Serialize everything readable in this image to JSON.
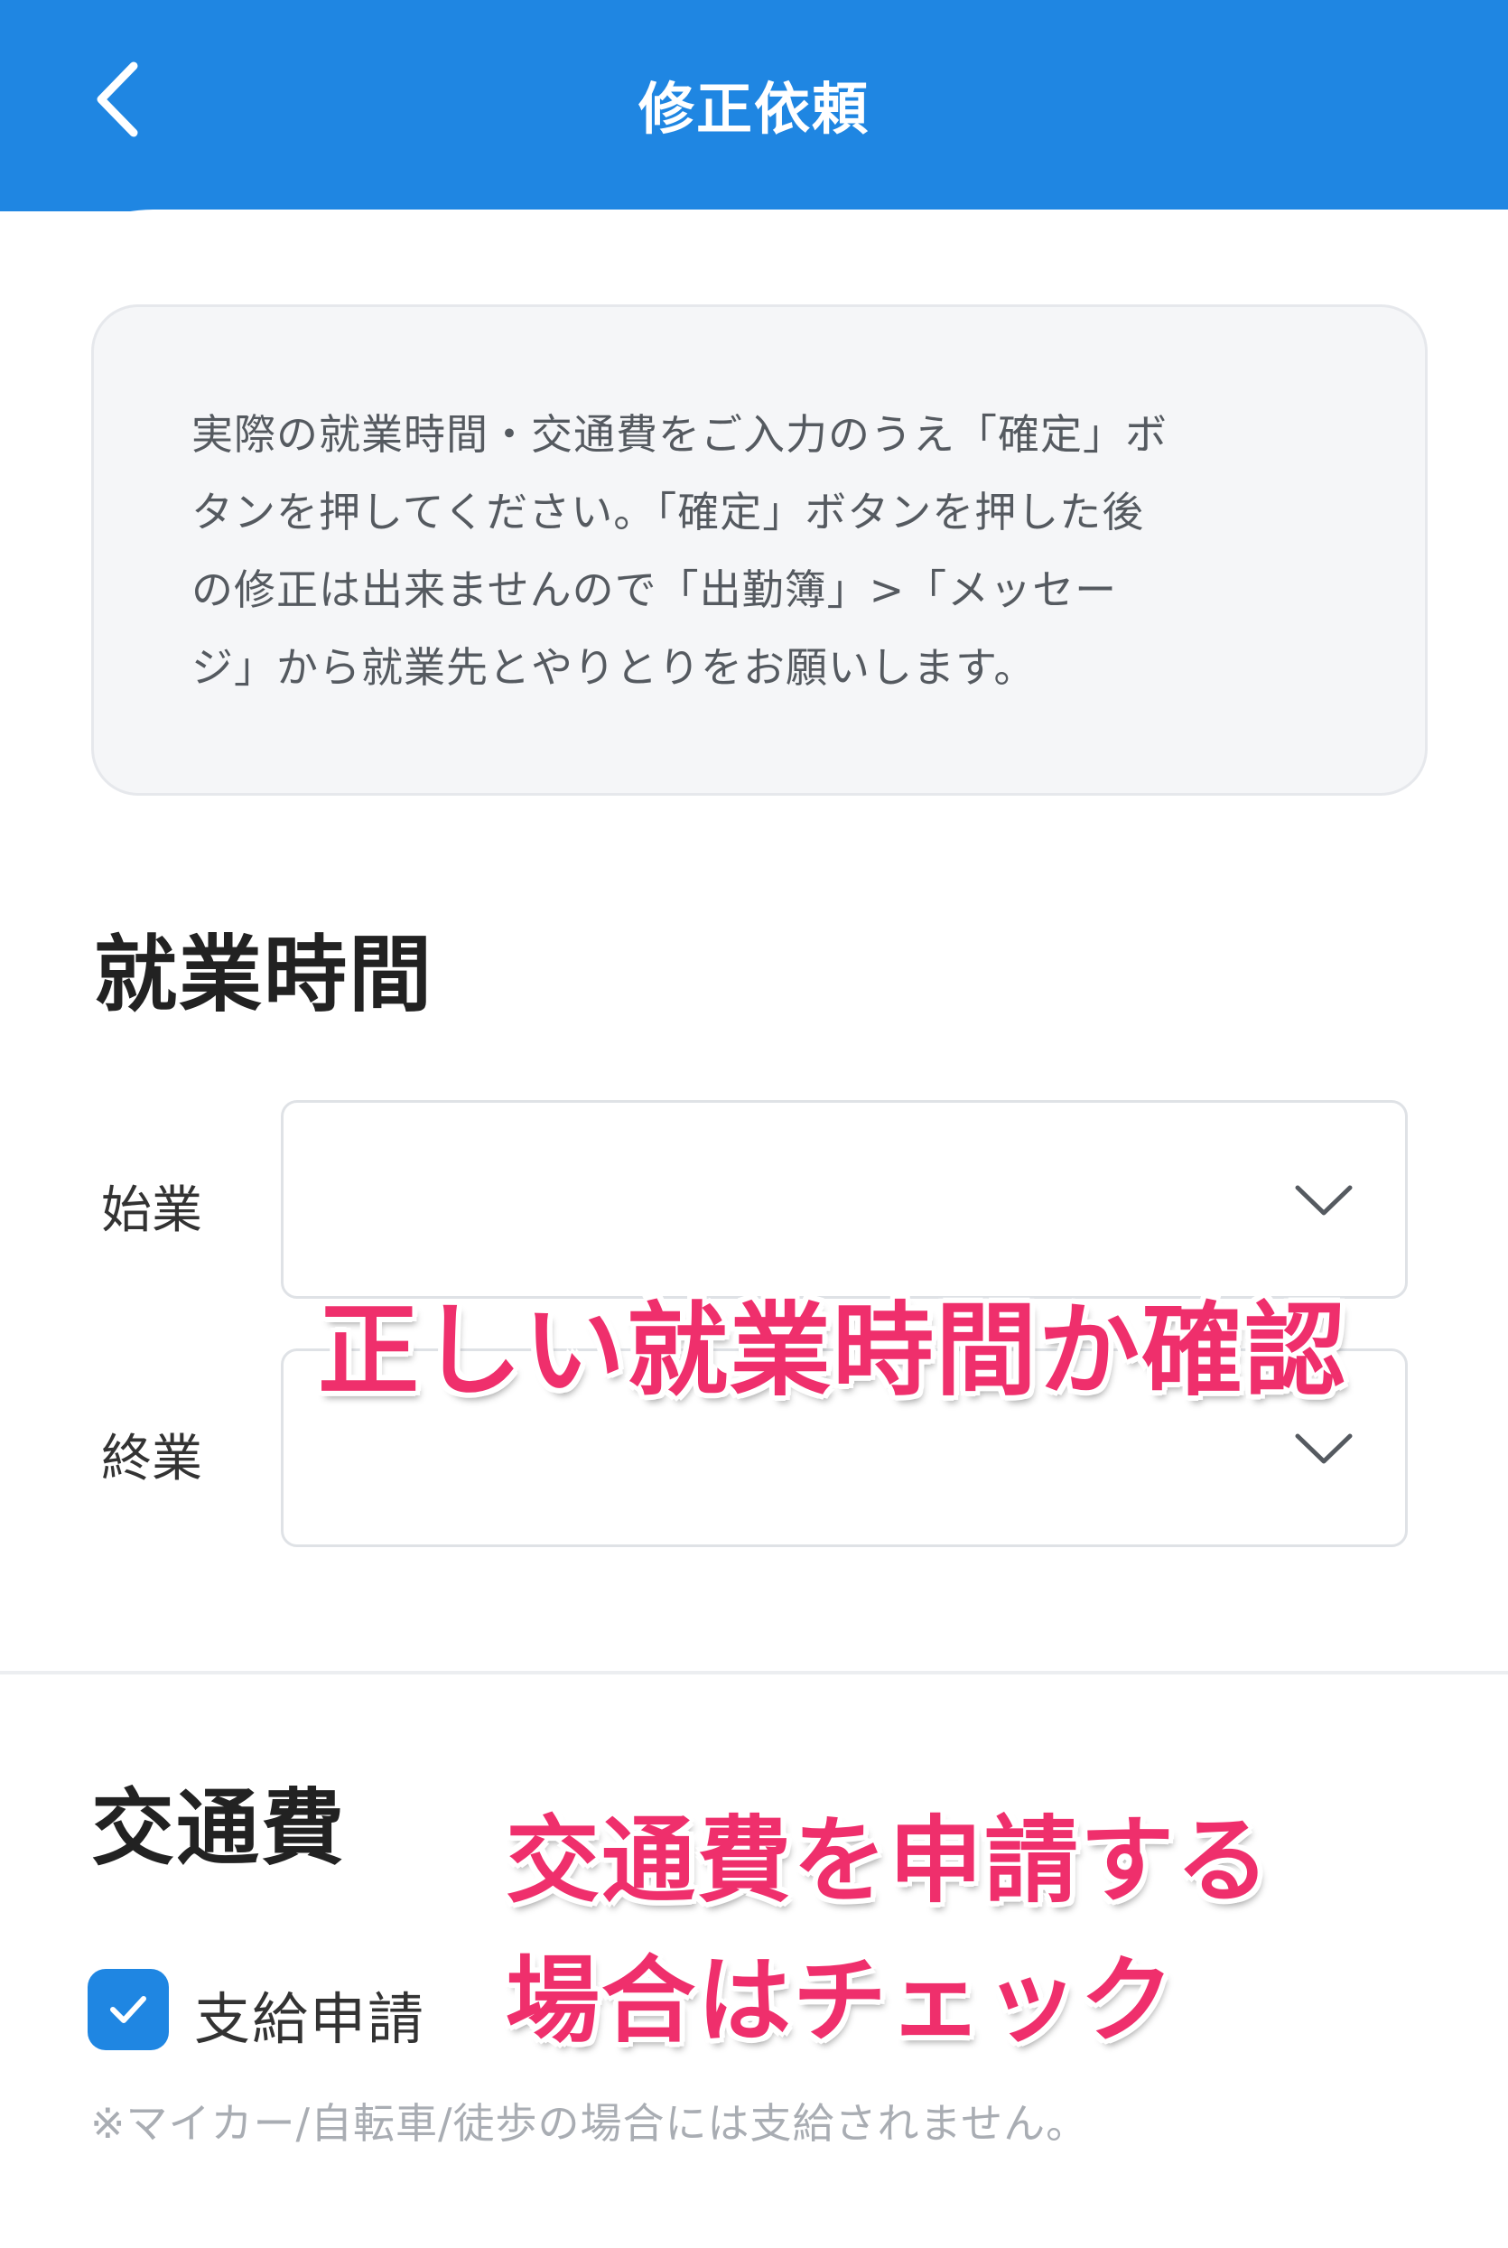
{
  "header": {
    "title": "修正依頼",
    "back_icon": "chevron-left-icon"
  },
  "notice": {
    "lines": [
      "実際の就業時間・交通費をご入力のうえ「確定」ボ",
      "タンを押してください。「確定」ボタンを押した後",
      "の修正は出来ませんので「出勤簿」>「メッセー",
      "ジ」から就業先とやりとりをお願いします。"
    ]
  },
  "work_time": {
    "title": "就業時間",
    "start_label": "始業",
    "start_value": "",
    "end_label": "終業",
    "end_value": ""
  },
  "transport": {
    "title": "交通費",
    "checkbox_label": "支給申請",
    "checked": true,
    "note": "※マイカー/自転車/徒歩の場合には支給されません。"
  },
  "annotations": {
    "work_time_hint": "正しい就業時間か確認",
    "transport_hint_line1": "交通費を申請する",
    "transport_hint_line2": "場合はチェック"
  },
  "colors": {
    "primary": "#1f86e2",
    "annotation": "#ef2f6c"
  }
}
